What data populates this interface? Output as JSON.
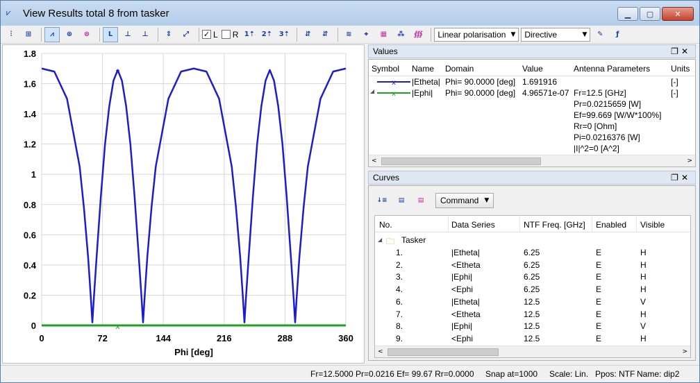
{
  "window": {
    "title": "View Results total 8 from tasker"
  },
  "toolbar": {
    "checkbox_l": {
      "label": "L",
      "checked": true
    },
    "checkbox_r": {
      "label": "R",
      "checked": false
    },
    "polarisation": "Linear polarisation",
    "gain_mode": "Directive"
  },
  "chart_data": {
    "type": "line",
    "xlabel": "Phi [deg]",
    "ylabel": "",
    "xlim": [
      0,
      360
    ],
    "ylim": [
      0,
      1.8
    ],
    "xticks": [
      "0",
      "72",
      "144",
      "216",
      "288",
      "360"
    ],
    "yticks": [
      "0",
      "0.2",
      "0.4",
      "0.6",
      "0.8",
      "1",
      "1.2",
      "1.4",
      "1.6",
      "1.8"
    ],
    "grid": true,
    "series": [
      {
        "name": "|Etheta|",
        "color": "#1c1ccf",
        "x": [
          0,
          15,
          30,
          45,
          50,
          55,
          58,
          60,
          62,
          65,
          70,
          75,
          80,
          85,
          90,
          95,
          100,
          105,
          110,
          115,
          118,
          120,
          122,
          125,
          130,
          135,
          150,
          165,
          180,
          195,
          210,
          225,
          230,
          235,
          238,
          240,
          242,
          245,
          250,
          255,
          260,
          265,
          270,
          275,
          280,
          285,
          290,
          295,
          298,
          300,
          302,
          305,
          310,
          315,
          330,
          345,
          360
        ],
        "y": [
          1.7,
          1.68,
          1.5,
          1.05,
          0.78,
          0.45,
          0.2,
          0.02,
          0.2,
          0.45,
          0.85,
          1.2,
          1.45,
          1.62,
          1.69,
          1.62,
          1.45,
          1.2,
          0.85,
          0.45,
          0.2,
          0.02,
          0.2,
          0.45,
          0.78,
          1.05,
          1.5,
          1.68,
          1.7,
          1.68,
          1.5,
          1.05,
          0.78,
          0.45,
          0.2,
          0.02,
          0.2,
          0.45,
          0.85,
          1.2,
          1.45,
          1.62,
          1.69,
          1.62,
          1.45,
          1.2,
          0.85,
          0.45,
          0.2,
          0.02,
          0.2,
          0.45,
          0.78,
          1.05,
          1.5,
          1.68,
          1.7
        ]
      },
      {
        "name": "|Ephi|",
        "color": "#1fa01f",
        "x": [
          0,
          90,
          180,
          270,
          360
        ],
        "y": [
          0,
          0,
          0,
          0,
          0
        ]
      }
    ],
    "markers": [
      {
        "series": 0,
        "x": 90,
        "y": 1.69,
        "label": "x"
      },
      {
        "series": 1,
        "x": 90,
        "y": 0,
        "label": "x"
      }
    ]
  },
  "values_panel": {
    "title": "Values",
    "headers": [
      "Symbol",
      "Name",
      "Domain",
      "Value",
      "Antenna Parameters",
      "Units"
    ],
    "rows": [
      {
        "name": "|Etheta|",
        "domain": "Phi= 90.0000 [deg]",
        "value": "1.691916",
        "params": [],
        "units": "[-]"
      },
      {
        "name": "|Ephi|",
        "domain": "Phi= 90.0000 [deg]",
        "value": "4.96571e-07",
        "params": [
          "Fr=12.5 [GHz]",
          "Pr=0.0215659 [W]",
          "Ef=99.669 [W/W*100%]",
          "Rr=0 [Ohm]",
          "Pi=0.0216376 [W]",
          "|I|^2=0 [A^2]"
        ],
        "units": "[-]"
      }
    ]
  },
  "curves_panel": {
    "title": "Curves",
    "command_label": "Command",
    "headers": [
      "No.",
      "Data Series",
      "NTF Freq. [GHz]",
      "Enabled",
      "Visible"
    ],
    "group": "Tasker",
    "rows": [
      {
        "no": "1.",
        "series": "|Etheta|",
        "freq": "6.25",
        "enabled": "E",
        "visible": "H"
      },
      {
        "no": "2.",
        "series": "<Etheta",
        "freq": "6.25",
        "enabled": "E",
        "visible": "H"
      },
      {
        "no": "3.",
        "series": "|Ephi|",
        "freq": "6.25",
        "enabled": "E",
        "visible": "H"
      },
      {
        "no": "4.",
        "series": "<Ephi",
        "freq": "6.25",
        "enabled": "E",
        "visible": "H"
      },
      {
        "no": "6.",
        "series": "|Etheta|",
        "freq": "12.5",
        "enabled": "E",
        "visible": "V"
      },
      {
        "no": "7.",
        "series": "<Etheta",
        "freq": "12.5",
        "enabled": "E",
        "visible": "H"
      },
      {
        "no": "8.",
        "series": "|Ephi|",
        "freq": "12.5",
        "enabled": "E",
        "visible": "V"
      },
      {
        "no": "9.",
        "series": "<Ephi",
        "freq": "12.5",
        "enabled": "E",
        "visible": "H"
      }
    ]
  },
  "status": {
    "params": "Fr=12.5000 Pr=0.0216 Ef= 99.67 Rr=0.0000",
    "snap": "Snap at=1000",
    "scale": "Scale: Lin.",
    "ppos": "Ppos: NTF",
    "name": "Name: dip2"
  }
}
